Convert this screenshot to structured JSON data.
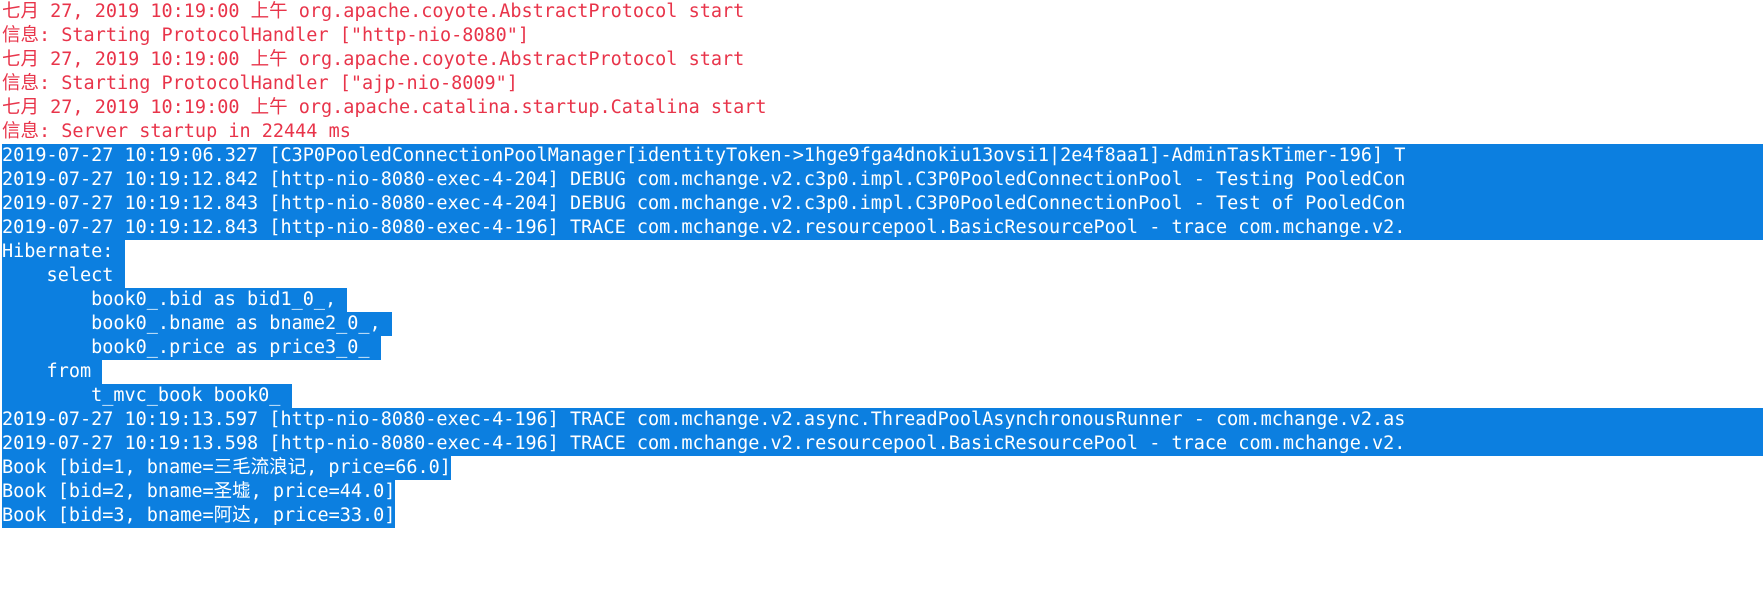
{
  "console": {
    "name": "console-output",
    "colors": {
      "background": "#ffffff",
      "error_text": "#e8344a",
      "selection_background": "#0c7fe0",
      "selection_text": "#ffffff"
    },
    "tomcat_log": [
      {
        "text": "七月 27, 2019 10:19:00 上午 org.apache.coyote.AbstractProtocol start"
      },
      {
        "text": "信息: Starting ProtocolHandler [\"http-nio-8080\"]"
      },
      {
        "text": "七月 27, 2019 10:19:00 上午 org.apache.coyote.AbstractProtocol start"
      },
      {
        "text": "信息: Starting ProtocolHandler [\"ajp-nio-8009\"]"
      },
      {
        "text": "七月 27, 2019 10:19:00 上午 org.apache.catalina.startup.Catalina start"
      },
      {
        "text": "信息: Server startup in 22444 ms"
      }
    ],
    "selected_log": [
      {
        "text": "2019-07-27 10:19:06.327 [C3P0PooledConnectionPoolManager[identityToken->1hge9fga4dnokiu13ovsi1|2e4f8aa1]-AdminTaskTimer-196] T",
        "full": true
      },
      {
        "text": "2019-07-27 10:19:12.842 [http-nio-8080-exec-4-204] DEBUG com.mchange.v2.c3p0.impl.C3P0PooledConnectionPool - Testing PooledCon",
        "full": true
      },
      {
        "text": "2019-07-27 10:19:12.843 [http-nio-8080-exec-4-204] DEBUG com.mchange.v2.c3p0.impl.C3P0PooledConnectionPool - Test of PooledCon",
        "full": true
      },
      {
        "text": "2019-07-27 10:19:12.843 [http-nio-8080-exec-4-196] TRACE com.mchange.v2.resourcepool.BasicResourcePool - trace com.mchange.v2.",
        "full": true
      },
      {
        "text": "Hibernate: ",
        "full": false
      },
      {
        "text": "    select ",
        "full": false
      },
      {
        "text": "        book0_.bid as bid1_0_, ",
        "full": false
      },
      {
        "text": "        book0_.bname as bname2_0_, ",
        "full": false
      },
      {
        "text": "        book0_.price as price3_0_ ",
        "full": false
      },
      {
        "text": "    from ",
        "full": false
      },
      {
        "text": "        t_mvc_book book0_ ",
        "full": false
      },
      {
        "text": "2019-07-27 10:19:13.597 [http-nio-8080-exec-4-196] TRACE com.mchange.v2.async.ThreadPoolAsynchronousRunner - com.mchange.v2.as",
        "full": true
      },
      {
        "text": "2019-07-27 10:19:13.598 [http-nio-8080-exec-4-196] TRACE com.mchange.v2.resourcepool.BasicResourcePool - trace com.mchange.v2.",
        "full": true
      },
      {
        "text": "Book [bid=1, bname=三毛流浪记, price=66.0]",
        "full": false
      },
      {
        "text": "Book [bid=2, bname=圣墟, price=44.0]",
        "full": false
      },
      {
        "text": "Book [bid=3, bname=阿达, price=33.0]",
        "full": false
      }
    ]
  }
}
